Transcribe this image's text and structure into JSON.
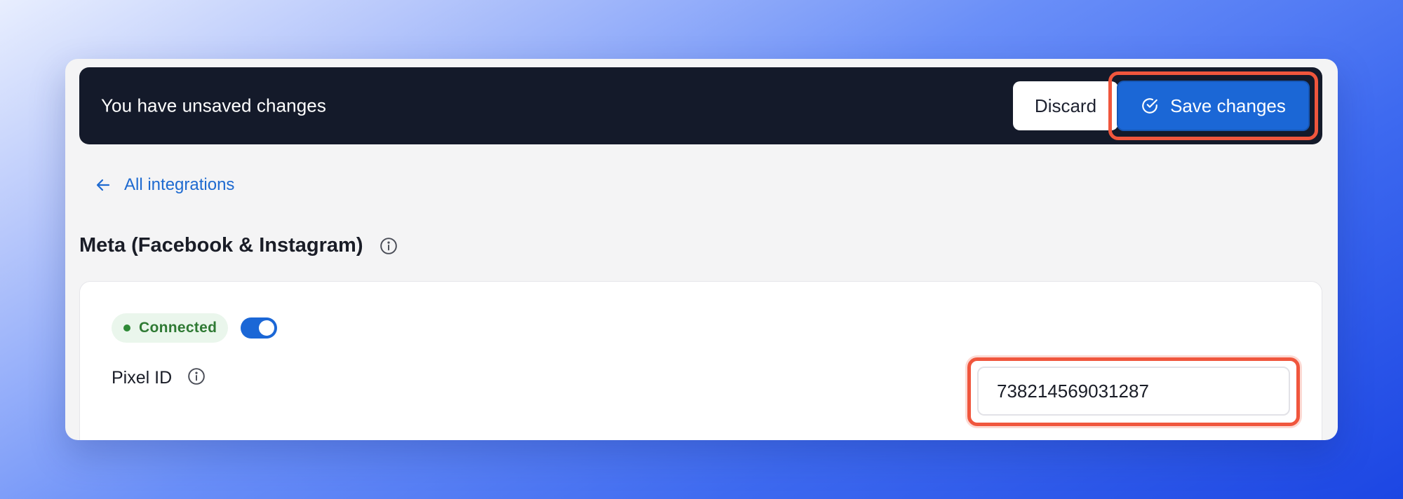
{
  "unsaved_bar": {
    "message": "You have unsaved changes",
    "discard_label": "Discard",
    "save_label": "Save changes"
  },
  "navigation": {
    "back_label": "All integrations"
  },
  "integration": {
    "title": "Meta (Facebook & Instagram)",
    "status_label": "Connected",
    "enabled": true,
    "pixel_id_label": "Pixel ID",
    "pixel_id_value": "738214569031287"
  },
  "colors": {
    "primary": "#1b67d6",
    "bar_background": "#141a2a",
    "highlight": "#f0563d",
    "connected_green": "#2f7a34"
  },
  "icons": {
    "save": "check-circle-icon",
    "back": "arrow-left-icon",
    "info": "info-icon"
  }
}
